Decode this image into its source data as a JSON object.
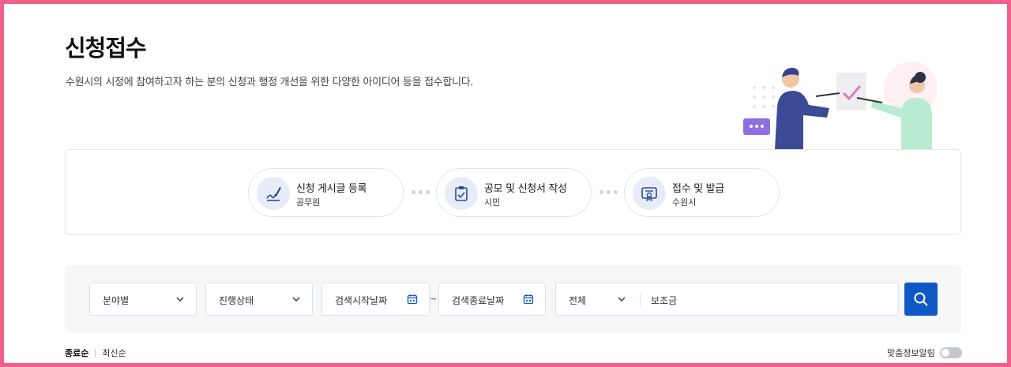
{
  "page": {
    "title": "신청접수",
    "description": "수원시의 시정에 참여하고자 하는 분의 신청과 행정 개선을 위한 다양한 아이디어 등을 접수합니다."
  },
  "steps": [
    {
      "title": "신청 게시글 등록",
      "actor": "공무원",
      "icon": "pen-signature-icon"
    },
    {
      "title": "공모 및 신청서 작성",
      "actor": "시민",
      "icon": "clipboard-check-icon"
    },
    {
      "title": "접수 및 발급",
      "actor": "수원시",
      "icon": "certificate-icon"
    }
  ],
  "search": {
    "field_select": "분야별",
    "status_select": "진행상태",
    "start_date_placeholder": "검색시작날짜",
    "end_date_placeholder": "검색종료날짜",
    "tilde": "~",
    "scope_select": "전체",
    "keyword_value": "보조금"
  },
  "sort": {
    "active": "종료순",
    "inactive": "최신순"
  },
  "notify": {
    "label": "맞춤정보알림",
    "enabled": false
  },
  "colors": {
    "frame": "#f0608a",
    "primary": "#1158c7",
    "icon_bg": "#e6edf8"
  }
}
